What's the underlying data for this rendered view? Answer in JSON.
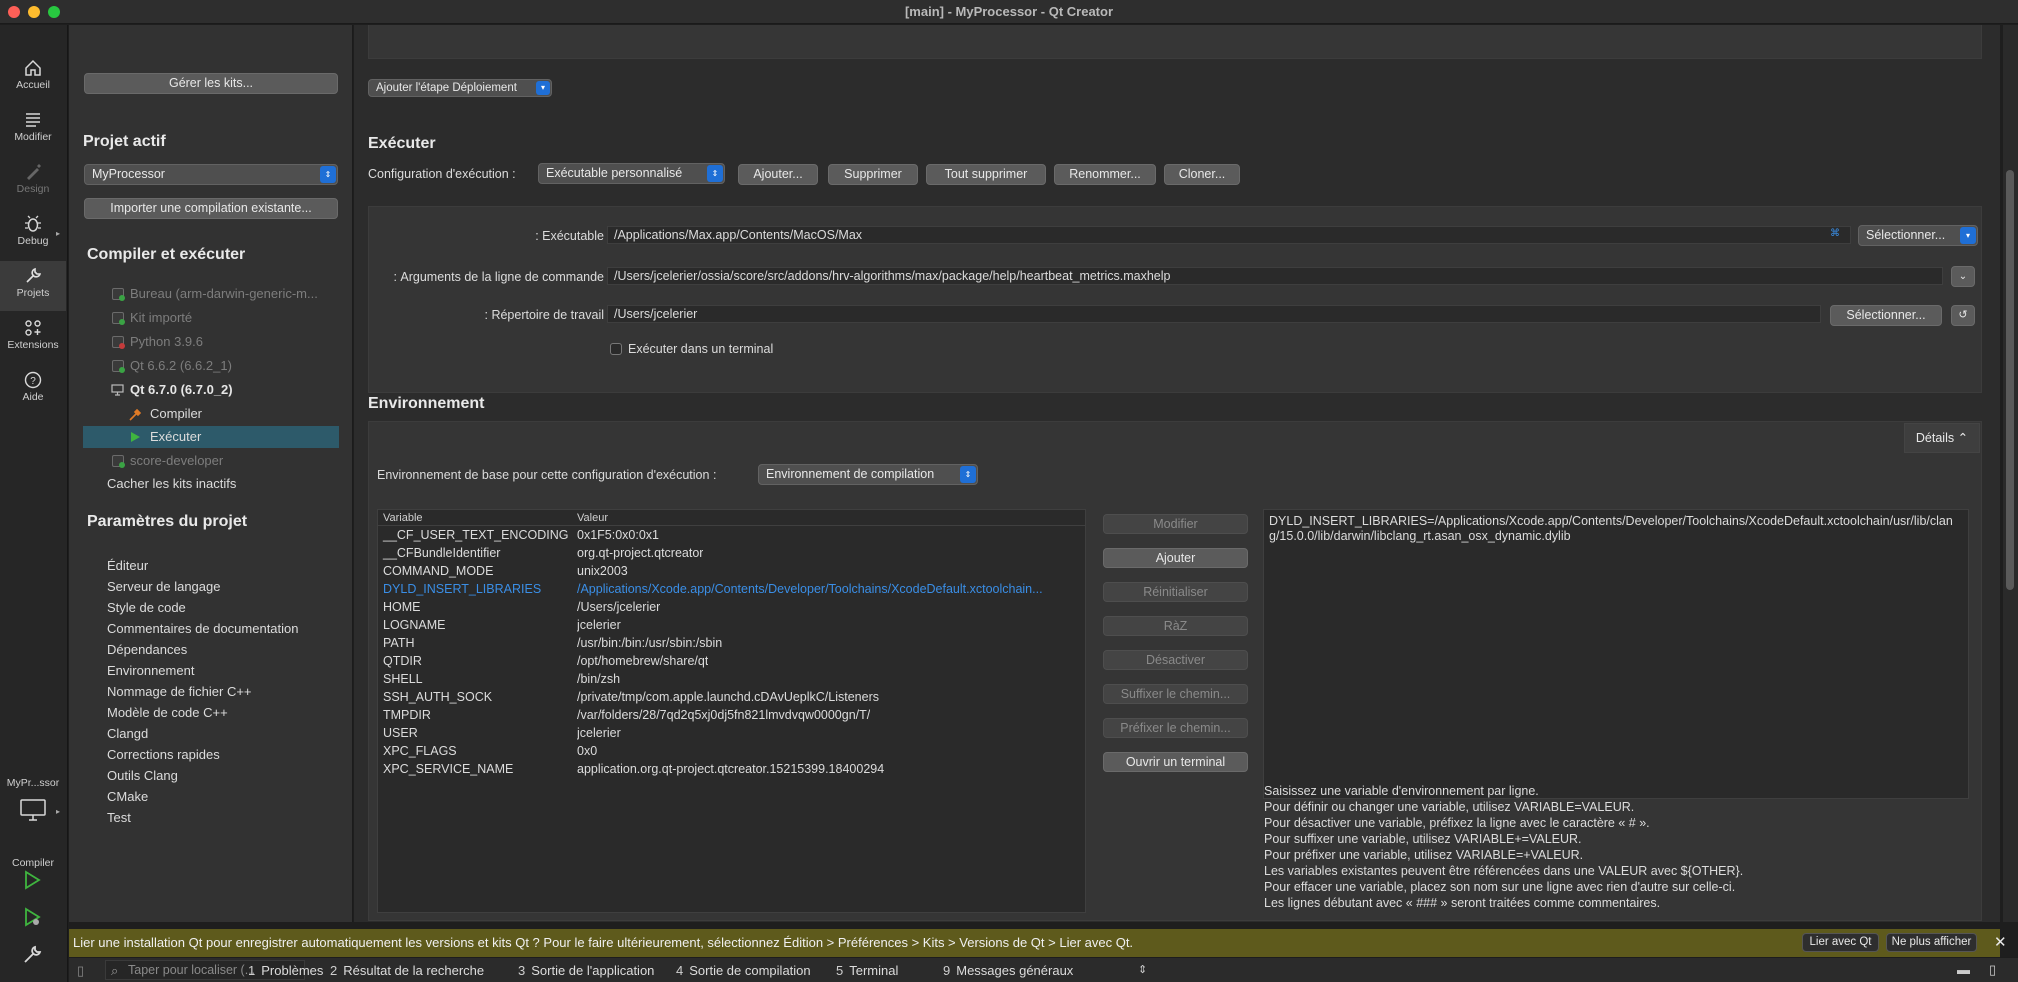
{
  "window": {
    "title": "[main] - MyProcessor - Qt Creator"
  },
  "modes": [
    {
      "label": "Accueil",
      "icon": "home-icon"
    },
    {
      "label": "Modifier",
      "icon": "edit-icon"
    },
    {
      "label": "Design",
      "icon": "design-icon"
    },
    {
      "label": "Debug",
      "icon": "debug-icon"
    },
    {
      "label": "Projets",
      "icon": "projects-icon"
    },
    {
      "label": "Extensions",
      "icon": "extensions-icon"
    },
    {
      "label": "Aide",
      "icon": "help-icon"
    }
  ],
  "kit_selector": {
    "project": "MyPr...ssor",
    "label": "Compiler"
  },
  "sidebar": {
    "manage_kits": "Gérer les kits...",
    "active_project_heading": "Projet actif",
    "active_project": "MyProcessor",
    "import_build": "Importer une compilation existante...",
    "build_run_heading": "Compiler et exécuter",
    "kits": [
      {
        "label": "Bureau (arm-darwin-generic-m..."
      },
      {
        "label": "Kit importé"
      },
      {
        "label": "Python 3.9.6"
      },
      {
        "label": "Qt 6.6.2 (6.6.2_1)"
      },
      {
        "label": "Qt 6.7.0 (6.7.0_2)"
      }
    ],
    "kit_children": [
      {
        "label": "Compiler"
      },
      {
        "label": "Exécuter"
      }
    ],
    "score_developer": "score-developer",
    "hide_inactive": "Cacher les kits inactifs",
    "project_settings_heading": "Paramètres du projet",
    "settings": [
      "Éditeur",
      "Serveur de langage",
      "Style de code",
      "Commentaires de documentation",
      "Dépendances",
      "Environnement",
      "Nommage de fichier C++",
      "Modèle de code C++",
      "Clangd",
      "Corrections rapides",
      "Outils Clang",
      "CMake",
      "Test"
    ]
  },
  "deploy": {
    "add_step": "Ajouter l'étape Déploiement"
  },
  "run": {
    "heading": "Exécuter",
    "config_label": "Configuration d'exécution :",
    "config_value": "Exécutable personnalisé",
    "buttons": {
      "add": "Ajouter...",
      "remove": "Supprimer",
      "remove_all": "Tout supprimer",
      "rename": "Renommer...",
      "clone": "Cloner..."
    },
    "executable_label": "Exécutable :",
    "executable_value": "/Applications/Max.app/Contents/MacOS/Max",
    "select": "Sélectionner...",
    "args_label": "Arguments de la ligne de commande :",
    "args_value": "/Users/jcelerier/ossia/score/src/addons/hrv-algorithms/max/package/help/heartbeat_metrics.maxhelp",
    "workdir_label": "Répertoire de travail :",
    "workdir_value": "/Users/jcelerier",
    "run_in_terminal": "Exécuter dans un terminal"
  },
  "environment": {
    "heading": "Environnement",
    "details": "Détails",
    "base_label": "Environnement de base pour cette configuration d'exécution :",
    "base_value": "Environnement de compilation",
    "columns": {
      "variable": "Variable",
      "value": "Valeur"
    },
    "rows": [
      {
        "variable": "__CF_USER_TEXT_ENCODING",
        "value": "0x1F5:0x0:0x1"
      },
      {
        "variable": "__CFBundleIdentifier",
        "value": "org.qt-project.qtcreator"
      },
      {
        "variable": "COMMAND_MODE",
        "value": "unix2003"
      },
      {
        "variable": "DYLD_INSERT_LIBRARIES",
        "value": "/Applications/Xcode.app/Contents/Developer/Toolchains/XcodeDefault.xctoolchain..."
      },
      {
        "variable": "HOME",
        "value": "/Users/jcelerier"
      },
      {
        "variable": "LOGNAME",
        "value": "jcelerier"
      },
      {
        "variable": "PATH",
        "value": "/usr/bin:/bin:/usr/sbin:/sbin"
      },
      {
        "variable": "QTDIR",
        "value": "/opt/homebrew/share/qt"
      },
      {
        "variable": "SHELL",
        "value": "/bin/zsh"
      },
      {
        "variable": "SSH_AUTH_SOCK",
        "value": "/private/tmp/com.apple.launchd.cDAvUeplkC/Listeners"
      },
      {
        "variable": "TMPDIR",
        "value": "/var/folders/28/7qd2q5xj0dj5fn821lmvdvqw0000gn/T/"
      },
      {
        "variable": "USER",
        "value": "jcelerier"
      },
      {
        "variable": "XPC_FLAGS",
        "value": "0x0"
      },
      {
        "variable": "XPC_SERVICE_NAME",
        "value": "application.org.qt-project.qtcreator.15215399.18400294"
      }
    ],
    "actions": {
      "edit": "Modifier",
      "add": "Ajouter",
      "reset": "Réinitialiser",
      "raz": "RàZ",
      "disable": "Désactiver",
      "append_path": "Suffixer le chemin...",
      "prepend_path": "Préfixer le chemin...",
      "open_terminal": "Ouvrir un terminal"
    },
    "editor_text": "DYLD_INSERT_LIBRARIES=/Applications/Xcode.app/Contents/Developer/Toolchains/XcodeDefault.xctoolchain/usr/lib/clang/15.0.0/lib/darwin/libclang_rt.asan_osx_dynamic.dylib",
    "help": [
      "Saisissez une variable d'environnement par ligne.",
      "Pour définir ou changer une variable, utilisez VARIABLE=VALEUR.",
      "Pour désactiver une variable, préfixez la ligne avec le caractère « # ».",
      "Pour suffixer une variable, utilisez VARIABLE+=VALEUR.",
      "Pour préfixer une variable, utilisez VARIABLE=+VALEUR.",
      "Les variables existantes peuvent être référencées dans une VALEUR avec ${OTHER}.",
      "Pour effacer une variable, placez son nom sur une ligne avec rien d'autre sur celle-ci.",
      "Les lignes débutant avec « ### » seront traitées comme commentaires."
    ]
  },
  "infobar": {
    "message": "Lier une installation Qt pour enregistrer automatiquement les versions et kits Qt ? Pour le faire ultérieurement, sélectionnez Édition > Préférences > Kits > Versions de Qt > Lier avec Qt.",
    "link": "Lier avec Qt",
    "dismiss": "Ne plus afficher"
  },
  "bottombar": {
    "locator_placeholder": "Taper pour localiser (...",
    "panes": [
      {
        "num": "1",
        "label": "Problèmes"
      },
      {
        "num": "2",
        "label": "Résultat de la recherche"
      },
      {
        "num": "3",
        "label": "Sortie de l'application"
      },
      {
        "num": "4",
        "label": "Sortie de compilation"
      },
      {
        "num": "5",
        "label": "Terminal"
      },
      {
        "num": "9",
        "label": "Messages généraux"
      }
    ]
  },
  "colors": {
    "accent": "#1f6fd6",
    "active_item": "#2d5a6a",
    "highlight_text": "#3a8ee6",
    "infobar": "#5e5a1c"
  }
}
